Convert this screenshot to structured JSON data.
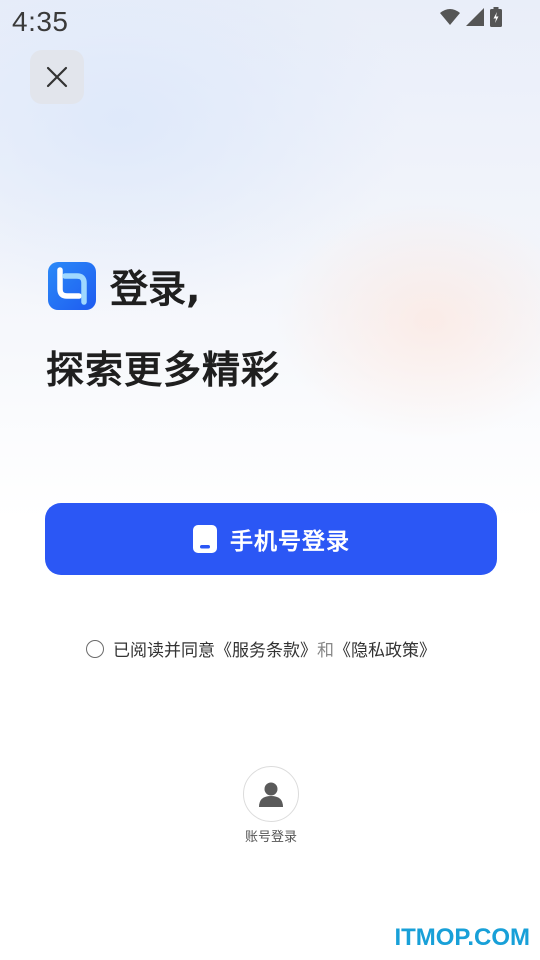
{
  "status_bar": {
    "time": "4:35",
    "icons": [
      "wifi-icon",
      "signal-icon",
      "battery-charging-icon"
    ]
  },
  "header": {
    "close_icon": "close-icon"
  },
  "hero": {
    "title": "登录,",
    "subtitle": "探索更多精彩"
  },
  "phone_login": {
    "label": "手机号登录",
    "icon": "phone-icon"
  },
  "agreement": {
    "prefix": "已阅读并同意",
    "terms": "《服务条款》",
    "and": "和",
    "privacy": "《隐私政策》",
    "checked": false
  },
  "account_login": {
    "label": "账号登录",
    "icon": "user-icon"
  },
  "watermark": {
    "text": "ITMOP.COM"
  },
  "colors": {
    "accent": "#2b57f5",
    "watermark": "#18a0d8"
  }
}
